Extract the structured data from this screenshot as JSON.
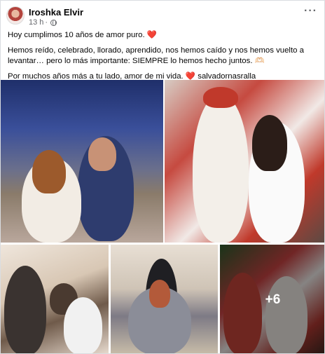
{
  "post": {
    "author": "Iroshka Elvir",
    "time": "13 h",
    "separator": "·",
    "more_label": "···",
    "line1": "Hoy cumplimos 10 años de amor puro.",
    "line1_emoji": "❤️",
    "line2": "Hemos reído, celebrado, llorado, aprendido, nos hemos caído y nos hemos vuelto a levantar… pero lo más importante: SIEMPRE lo hemos hecho juntos.",
    "line2_emoji": "🫶🏻",
    "line3": "Por muchos años más a tu lado, amor de mi vida.",
    "line3_emoji": "❤️",
    "line3_tag": "salvadornasralla"
  },
  "photos": {
    "more_count": "+6"
  }
}
